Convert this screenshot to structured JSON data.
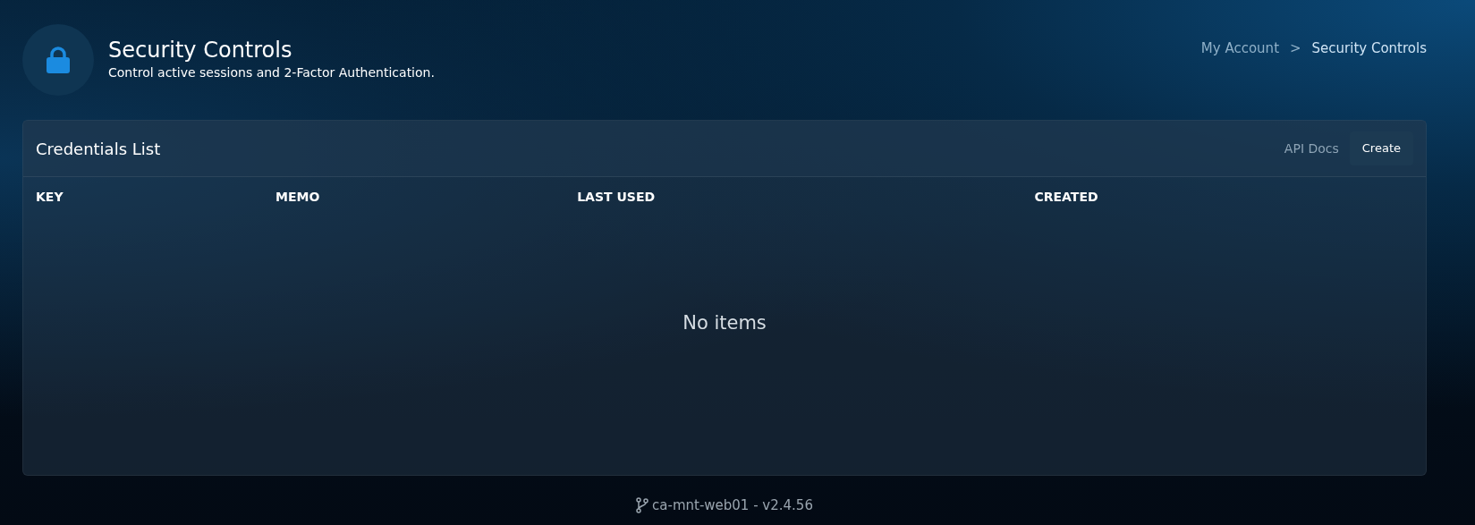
{
  "header": {
    "title": "Security Controls",
    "subtitle": "Control active sessions and 2-Factor Authentication."
  },
  "breadcrumb": [
    {
      "label": "My Account",
      "current": false
    },
    {
      "label": "Security Controls",
      "current": true
    }
  ],
  "breadcrumb_separator": ">",
  "card": {
    "title": "Credentials List",
    "actions": [
      {
        "label": "API Docs",
        "kind": "link"
      },
      {
        "label": "Create",
        "kind": "button"
      }
    ],
    "table": {
      "columns": [
        "KEY",
        "MEMO",
        "LAST USED",
        "CREATED"
      ],
      "empty_text": "No items"
    }
  },
  "footer": {
    "text": "ca-mnt-web01 - v2.4.56"
  }
}
